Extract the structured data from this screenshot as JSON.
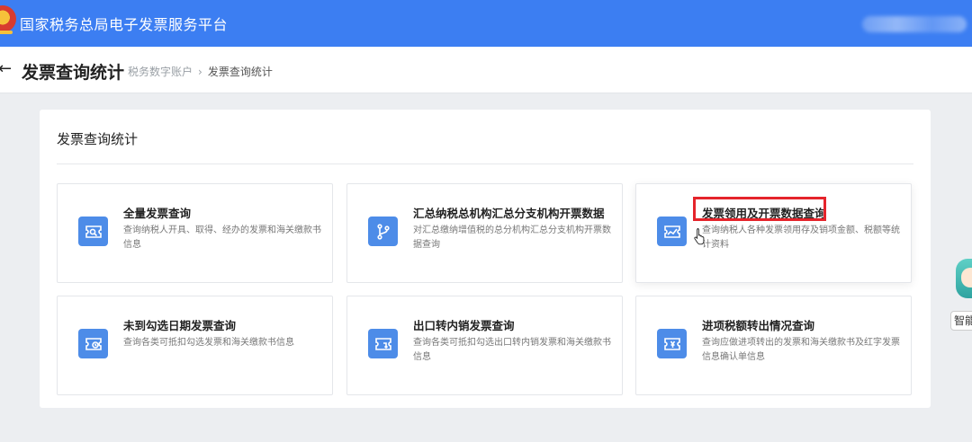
{
  "topbar": {
    "app_title": "国家税务总局电子发票服务平台",
    "logo_icon": "tax-emblem-icon",
    "bg_color": "#3c7ef2"
  },
  "header": {
    "back_icon": "←",
    "page_title": "发票查询统计",
    "breadcrumb": [
      "税务数字账户",
      "发票查询统计"
    ],
    "breadcrumb_separator": "›"
  },
  "panel": {
    "section_title": "发票查询统计",
    "cards": [
      {
        "title": "全量发票查询",
        "desc": "查询纳税人开具、取得、经办的发票和海关缴款书信息",
        "icon": "invoice-search-icon"
      },
      {
        "title": "汇总纳税总机构汇总分支机构开票数据",
        "desc": "对汇总缴纳增值税的总分机构汇总分支机构开票数据查询",
        "icon": "branch-icon"
      },
      {
        "title": "发票领用及开票数据查询",
        "desc": "查询纳税人各种发票领用存及销项金额、税额等统计资料",
        "icon": "trend-chart-icon"
      },
      {
        "title": "未到勾选日期发票查询",
        "desc": "查询各类可抵扣勾选发票和海关缴款书信息",
        "icon": "clock-ticket-icon"
      },
      {
        "title": "出口转内销发票查询",
        "desc": "查询各类可抵扣勾选出口转内销发票和海关缴款书信息",
        "icon": "transfer-ticket-icon"
      },
      {
        "title": "进项税额转出情况查询",
        "desc": "查询应做进项转出的发票和海关缴款书及红字发票信息确认单信息",
        "icon": "yuan-ticket-icon"
      }
    ],
    "highlighted_card_index": 2,
    "highlight_color": "#e5242b",
    "icon_color": "#4d8ce8"
  },
  "assistant": {
    "label": "智能",
    "icon": "assistant-avatar-icon"
  }
}
